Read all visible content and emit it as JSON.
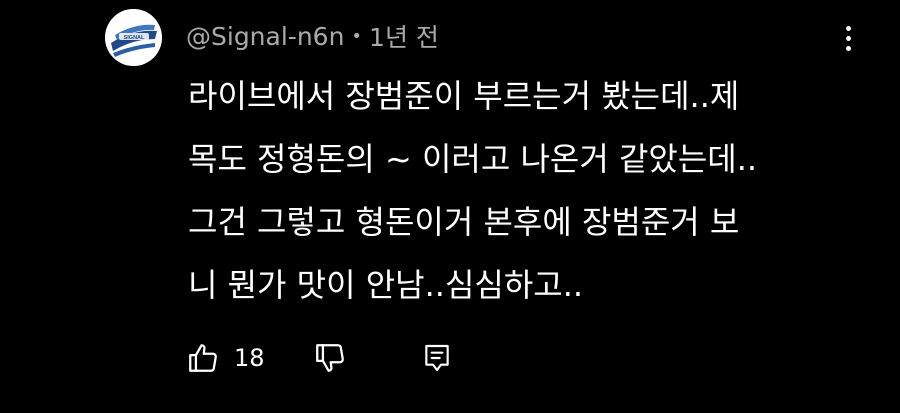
{
  "comment": {
    "author": "@Signal-n6n",
    "separator": "•",
    "timestamp": "1년 전",
    "lines": [
      "라이브에서 장범준이 부르는거 봤는데..제",
      "목도 정형돈의 ~ 이러고 나온거 같았는데..",
      "그건 그렇고 형돈이거 본후에 장범준거 보",
      "니 뭔가 맛이 안남..심심하고.."
    ],
    "like_count": "18",
    "avatar_badge": "SIGNAL"
  },
  "colors": {
    "background": "#000000",
    "text": "#ffffff",
    "meta_text": "#aaaaaa",
    "avatar_accent": "#1f4a86"
  },
  "icons": {
    "like": "thumbs-up-icon",
    "dislike": "thumbs-down-icon",
    "reply": "reply-comment-icon",
    "more": "more-vertical-icon"
  }
}
